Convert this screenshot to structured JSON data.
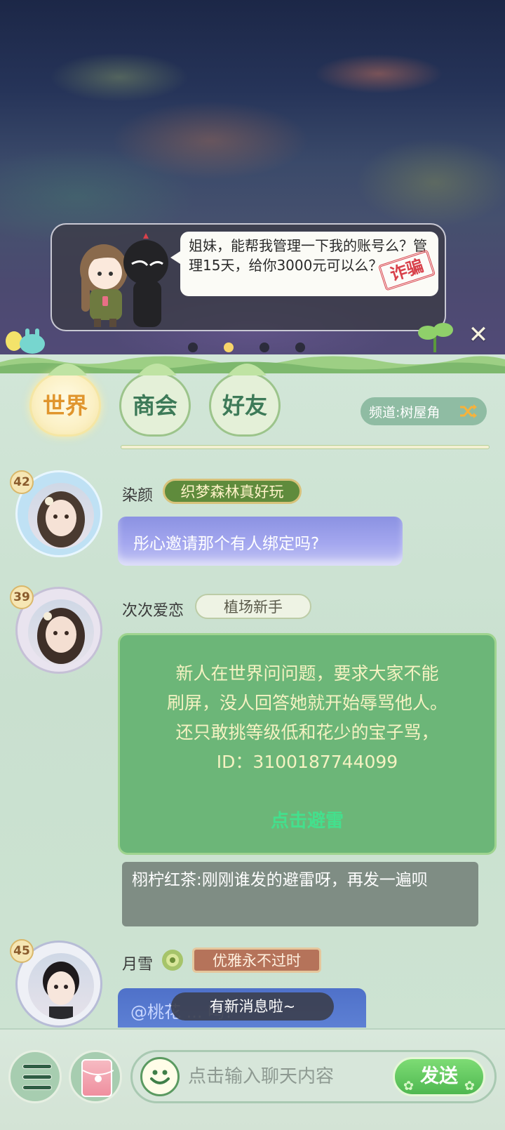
{
  "banner": {
    "message": "姐妹，能帮我管理一下我的账号么？管理15天，给你3000元可以么？",
    "stamp": "诈骗",
    "page_count": 4,
    "active_page": 2
  },
  "tabs": [
    {
      "label": "世界",
      "active": true
    },
    {
      "label": "商会",
      "active": false
    },
    {
      "label": "好友",
      "active": false
    }
  ],
  "channel": {
    "label": "频道:树屋角"
  },
  "messages": [
    {
      "level": "42",
      "username": "染颜",
      "title": "织梦森林真好玩",
      "text": "彤心邀请那个有人绑定吗?"
    },
    {
      "level": "39",
      "username": "次次爱恋",
      "title": "植场新手",
      "lines": [
        "新人在世界问问题，要求大家不能",
        "刷屏，没人回答她就开始辱骂他人。",
        "还只敢挑等级低和花少的宝子骂，",
        "ID：3100187744099"
      ],
      "link": "点击避雷",
      "reply": "栩柠红茶:刚刚谁发的避雷呀，再发一遍呗"
    },
    {
      "level": "45",
      "username": "月雪",
      "title": "优雅永不过时",
      "text": "@桃花 ... 吗?"
    }
  ],
  "new_message_notice": "有新消息啦~",
  "input": {
    "placeholder": "点击输入聊天内容",
    "value": "",
    "send_label": "发送"
  },
  "icons": {
    "close": "close-icon",
    "shuffle": "shuffle-icon",
    "menu": "menu-icon",
    "red_packet": "red-packet-icon",
    "emoji": "smiley-icon"
  },
  "colors": {
    "tab_active_text": "#e0952d",
    "tab_text": "#3d7a58",
    "send_button": "#4fb851",
    "avoid_link": "#43e08d",
    "fraud_stamp": "#d8414b"
  }
}
